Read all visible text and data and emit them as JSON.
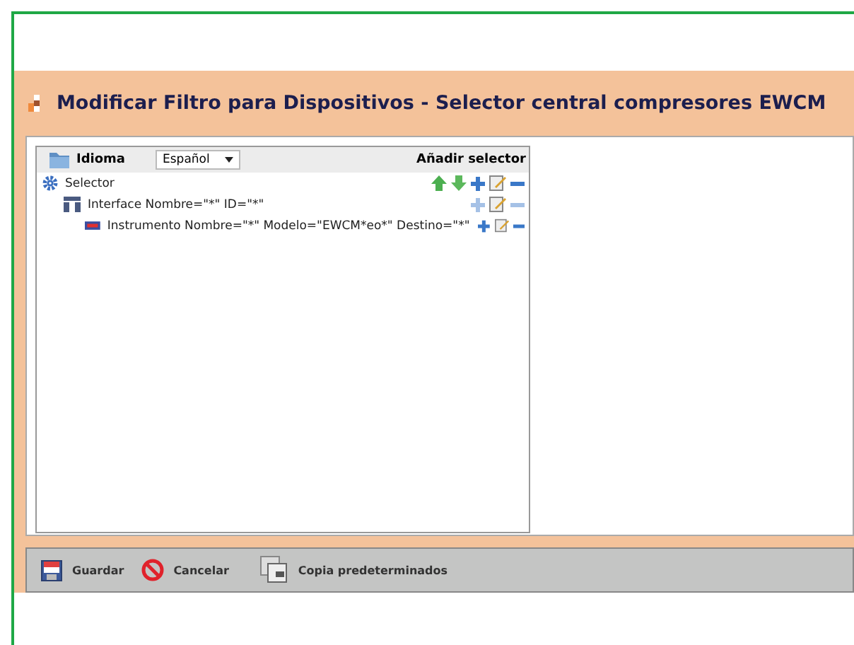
{
  "window": {
    "title": "Modificar Filtro para Dispositivos - Selector central compresores EWCM"
  },
  "header": {
    "language_label": "Idioma",
    "language_value": "Español",
    "add_selector": "Añadir selector"
  },
  "tree": [
    {
      "label": "Selector",
      "kind": "selector",
      "actions": [
        {
          "kind": "up",
          "disabled": false
        },
        {
          "kind": "down",
          "disabled": false
        },
        {
          "kind": "add",
          "disabled": false
        },
        {
          "kind": "edit",
          "disabled": false
        },
        {
          "kind": "remove",
          "disabled": false
        }
      ],
      "children": [
        {
          "label": "Interface Nombre=\"*\" ID=\"*\"",
          "kind": "interface",
          "actions": [
            {
              "kind": "add",
              "disabled": true
            },
            {
              "kind": "edit",
              "disabled": false
            },
            {
              "kind": "remove",
              "disabled": true
            }
          ],
          "children": [
            {
              "label": "Instrumento Nombre=\"*\" Modelo=\"EWCM*eo*\" Destino=\"*\"",
              "kind": "instrument",
              "actions": [
                {
                  "kind": "add",
                  "disabled": false
                },
                {
                  "kind": "edit",
                  "disabled": false
                },
                {
                  "kind": "remove",
                  "disabled": false
                }
              ]
            }
          ]
        }
      ]
    }
  ],
  "toolbar": [
    {
      "label": "Guardar",
      "kind": "save"
    },
    {
      "label": "Cancelar",
      "kind": "cancel"
    },
    {
      "label": "Copia predeterminados",
      "kind": "copy"
    }
  ]
}
